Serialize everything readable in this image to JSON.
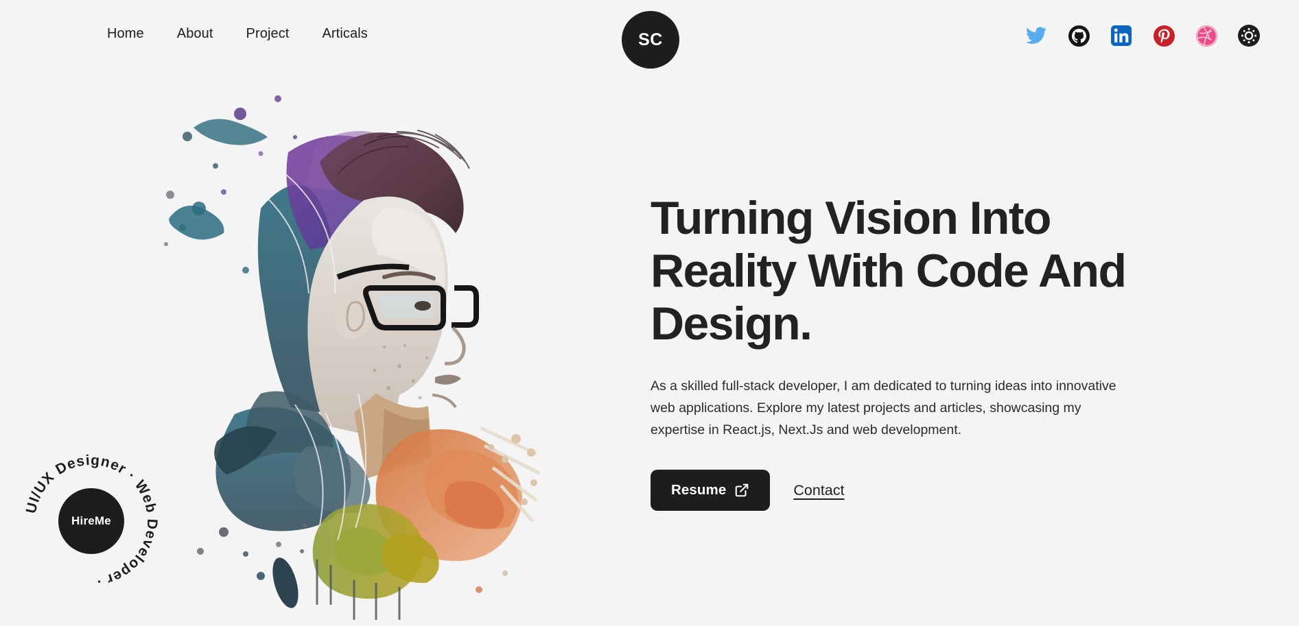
{
  "theme": {
    "background": "#f4f4f4",
    "ink": "#1d1d1d",
    "accent_dark": "#222222"
  },
  "header": {
    "logo": {
      "label": "SC",
      "name": "sc-logo"
    },
    "nav": [
      {
        "label": "Home"
      },
      {
        "label": "About"
      },
      {
        "label": "Project"
      },
      {
        "label": "Articals"
      }
    ],
    "socials": [
      {
        "name": "twitter-icon",
        "label": "Twitter",
        "color": "#55acee"
      },
      {
        "name": "github-icon",
        "label": "GitHub",
        "color": "#171515"
      },
      {
        "name": "linkedin-icon",
        "label": "LinkedIn",
        "color": "#0a66c2"
      },
      {
        "name": "pinterest-icon",
        "label": "Pinterest",
        "color": "#cb2027"
      },
      {
        "name": "dribbble-icon",
        "label": "Dribbble",
        "color": "#ea4c89"
      },
      {
        "name": "theme-toggle-sun-icon",
        "label": "Toggle theme",
        "color": "#1d1d1d"
      }
    ]
  },
  "hero": {
    "portrait_alt": "Watercolor splash illustration of a man in profile wearing glasses",
    "headline": "Turning Vision Into Reality With Code And Design.",
    "paragraph": "As a skilled full-stack developer, I am dedicated to turning ideas into innovative web applications. Explore my latest projects and articles, showcasing my expertise in React.js, Next.Js and web development.",
    "primary_button": "Resume",
    "secondary_link": "Contact"
  },
  "hire_badge": {
    "center_label": "HireMe",
    "ring_text": "UI/UX Designer · Web Developer · "
  }
}
